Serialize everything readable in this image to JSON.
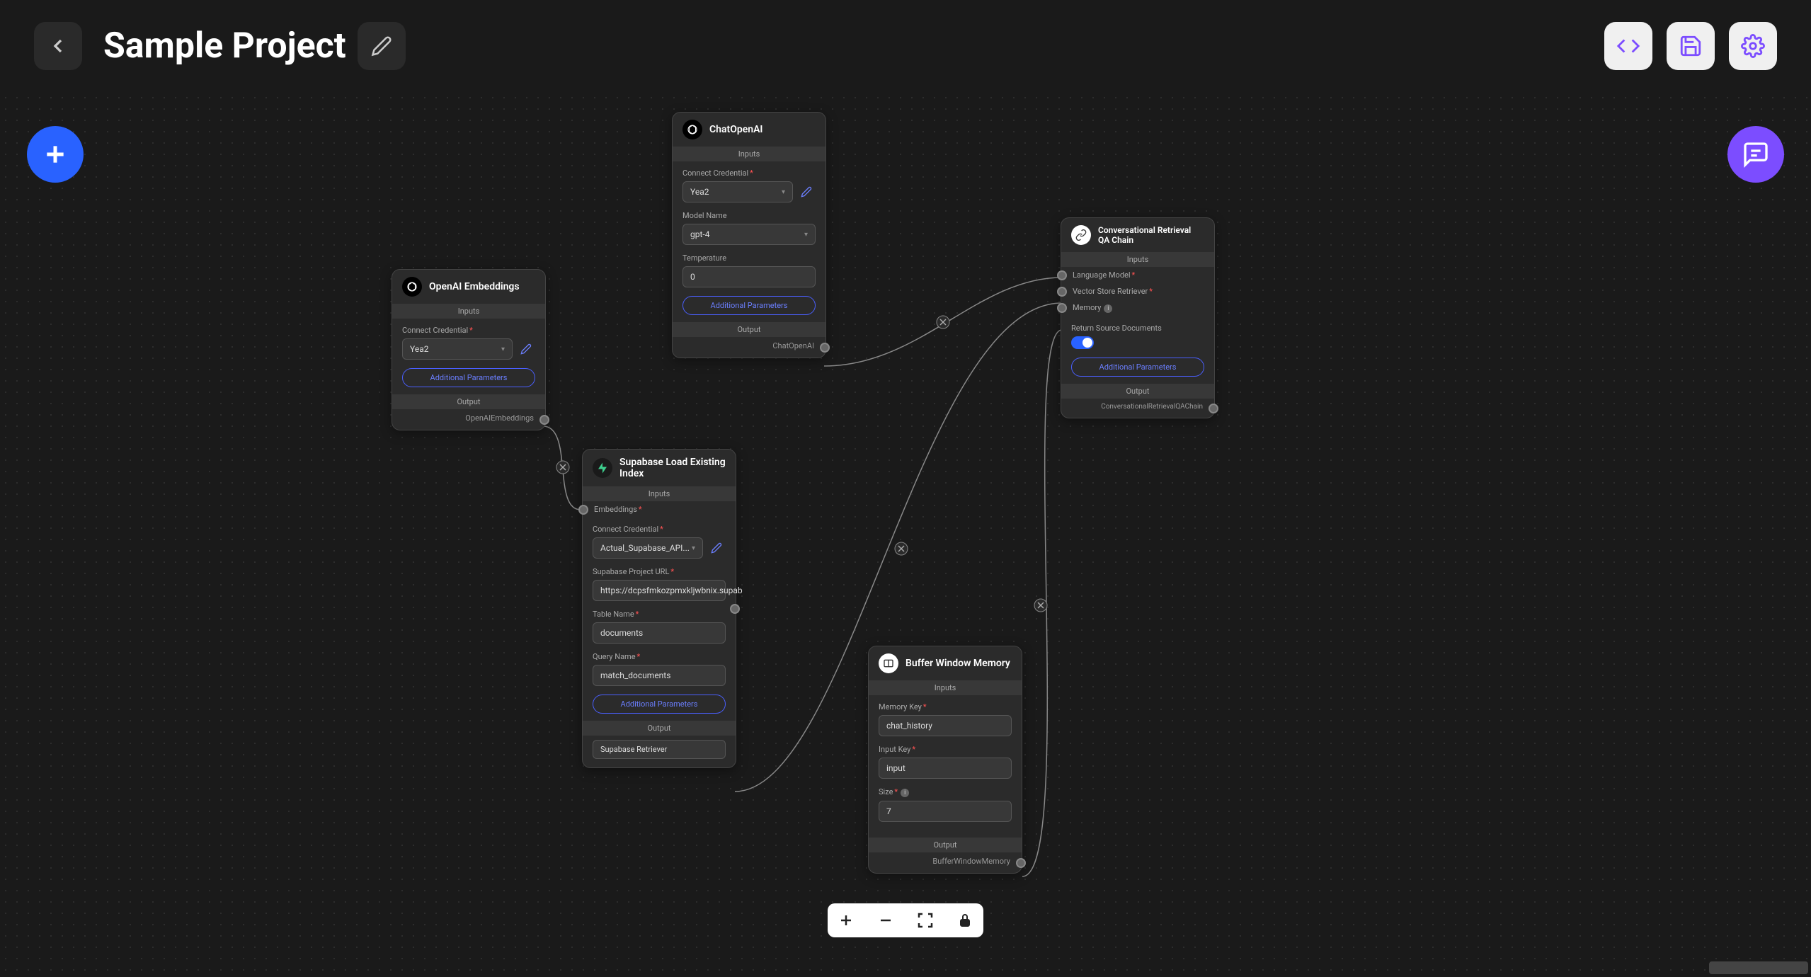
{
  "header": {
    "project_title": "Sample Project"
  },
  "nodes": {
    "openai_embeddings": {
      "title": "OpenAI Embeddings",
      "inputs_label": "Inputs",
      "connect_credential_label": "Connect Credential",
      "connect_credential_value": "Yea2",
      "additional_params": "Additional Parameters",
      "output_label": "Output",
      "output_port": "OpenAIEmbeddings"
    },
    "chat_openai": {
      "title": "ChatOpenAI",
      "inputs_label": "Inputs",
      "connect_credential_label": "Connect Credential",
      "connect_credential_value": "Yea2",
      "model_name_label": "Model Name",
      "model_name_value": "gpt-4",
      "temperature_label": "Temperature",
      "temperature_value": "0",
      "additional_params": "Additional Parameters",
      "output_label": "Output",
      "output_port": "ChatOpenAI"
    },
    "supabase": {
      "title": "Supabase Load Existing Index",
      "inputs_label": "Inputs",
      "embeddings_port": "Embeddings",
      "connect_credential_label": "Connect Credential",
      "connect_credential_value": "Actual_Supabase_API...",
      "project_url_label": "Supabase Project URL",
      "project_url_value": "https://dcpsfmkozpmxkljwbnix.supab",
      "table_name_label": "Table Name",
      "table_name_value": "documents",
      "query_name_label": "Query Name",
      "query_name_value": "match_documents",
      "additional_params": "Additional Parameters",
      "output_label": "Output",
      "output_select": "Supabase Retriever"
    },
    "buffer_memory": {
      "title": "Buffer Window Memory",
      "inputs_label": "Inputs",
      "memory_key_label": "Memory Key",
      "memory_key_value": "chat_history",
      "input_key_label": "Input Key",
      "input_key_value": "input",
      "size_label": "Size",
      "size_value": "7",
      "output_label": "Output",
      "output_port": "BufferWindowMemory"
    },
    "conv_chain": {
      "title": "Conversational Retrieval QA Chain",
      "inputs_label": "Inputs",
      "language_model_port": "Language Model",
      "vector_retriever_port": "Vector Store Retriever",
      "memory_port": "Memory",
      "return_docs_label": "Return Source Documents",
      "additional_params": "Additional Parameters",
      "output_label": "Output",
      "output_port": "ConversationalRetrievalQAChain"
    }
  }
}
